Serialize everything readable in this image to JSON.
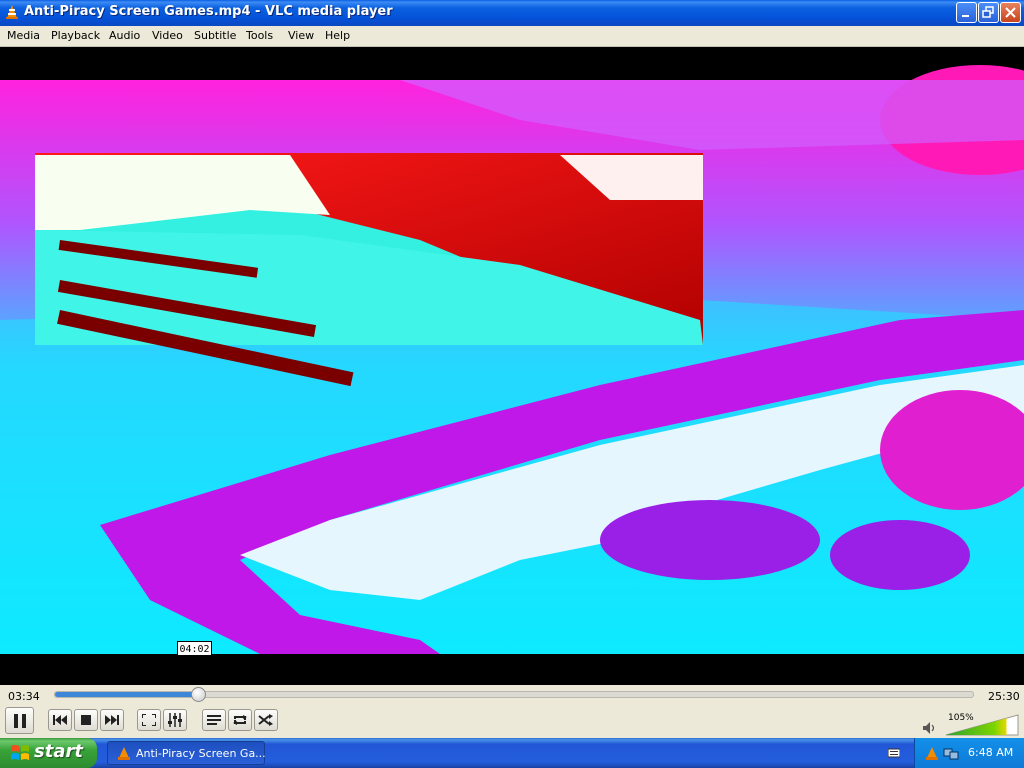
{
  "window": {
    "title": "Anti-Piracy Screen Games.mp4 - VLC media player"
  },
  "menu": {
    "items": [
      "Media",
      "Playback",
      "Audio",
      "Video",
      "Subtitle",
      "Tools",
      "View",
      "Help"
    ]
  },
  "player": {
    "elapsed": "03:34",
    "total": "25:30",
    "hover_time": "04:02",
    "progress_fraction": 0.156,
    "volume_label": "105%",
    "volume_fraction": 1.05
  },
  "taskbar": {
    "start_label": "start",
    "task_label": "Anti-Piracy Screen Ga...",
    "clock": "6:48 AM"
  },
  "colors": {
    "accent": "#3d86d8",
    "titlebar": "#0551d8",
    "panel": "#ece9d8",
    "start_green": "#39a339"
  },
  "icons": {
    "play_pause": "pause-icon",
    "prev": "previous-icon",
    "stop": "stop-icon",
    "next": "next-icon",
    "fullscreen": "fullscreen-icon",
    "extended": "equalizer-icon",
    "playlist": "playlist-icon",
    "loop": "loop-icon",
    "shuffle": "shuffle-icon",
    "volume": "speaker-icon"
  }
}
